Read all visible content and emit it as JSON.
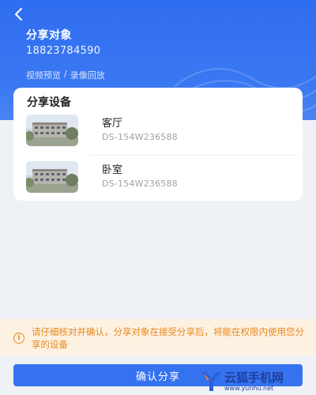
{
  "header": {
    "title": "分享对象",
    "phone": "18823784590",
    "permissions": [
      "视频预览",
      "/",
      "录像回放"
    ]
  },
  "devices_section": {
    "title": "分享设备",
    "devices": [
      {
        "name": "客厅",
        "model": "DS-154W236588",
        "icon": "building-thumbnail"
      },
      {
        "name": "卧室",
        "model": "DS-154W236588",
        "icon": "building-thumbnail"
      }
    ]
  },
  "notice": {
    "icon": "info-icon",
    "text": "请仔细核对并确认，分享对象在接受分享后，将能在权限内使用您分享的设备"
  },
  "confirm": {
    "label": "确认分享"
  },
  "watermark": {
    "cn": "云狐手机网",
    "url": "www.yunhu.net"
  },
  "colors": {
    "header_blue": "#2f6df0",
    "button_blue": "#3472f0",
    "notice_orange": "#e8891e",
    "notice_bg": "#fdf1e2"
  }
}
